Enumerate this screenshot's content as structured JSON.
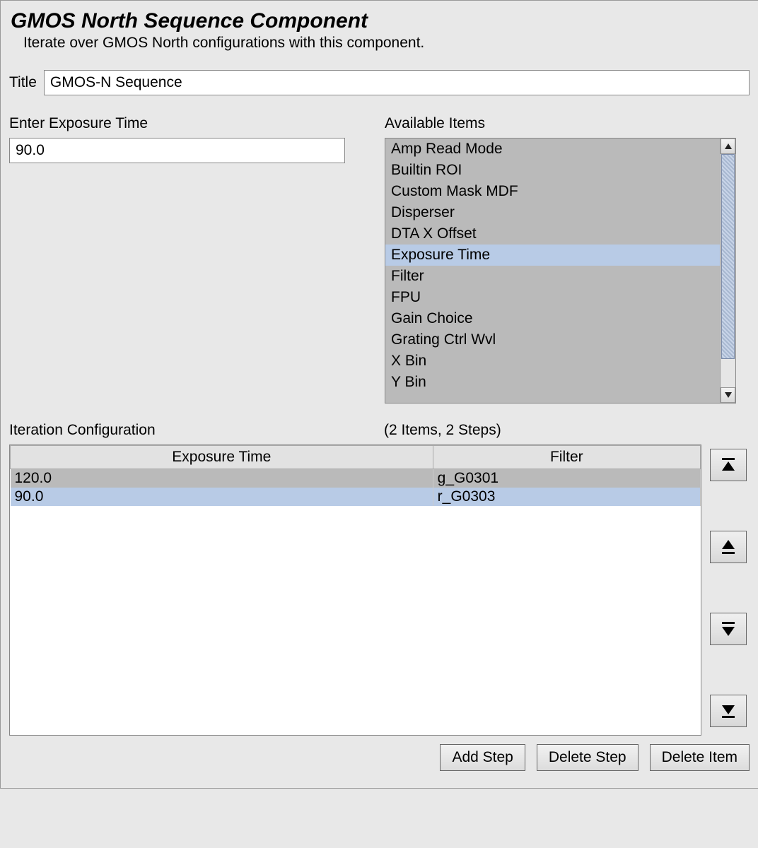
{
  "header": {
    "title": "GMOS North Sequence Component",
    "subtitle": "Iterate over GMOS North configurations with this component."
  },
  "title_field": {
    "label": "Title",
    "value": "GMOS-N Sequence"
  },
  "exposure": {
    "label": "Enter Exposure Time",
    "value": "90.0"
  },
  "available": {
    "label": "Available Items",
    "items": [
      "Amp Read Mode",
      "Builtin ROI",
      "Custom Mask MDF",
      "Disperser",
      "DTA X Offset",
      "Exposure Time",
      "Filter",
      "FPU",
      "Gain Choice",
      "Grating Ctrl Wvl",
      "X Bin",
      "Y Bin"
    ],
    "selected_index": 5
  },
  "config": {
    "label": "Iteration Configuration",
    "summary": "(2 Items, 2 Steps)",
    "columns": [
      "Exposure Time",
      "Filter"
    ],
    "rows": [
      {
        "exposure": "120.0",
        "filter": "g_G0301"
      },
      {
        "exposure": "90.0",
        "filter": "r_G0303"
      }
    ],
    "selected_row": 1
  },
  "buttons": {
    "add_step": "Add Step",
    "delete_step": "Delete Step",
    "delete_item": "Delete Item"
  }
}
